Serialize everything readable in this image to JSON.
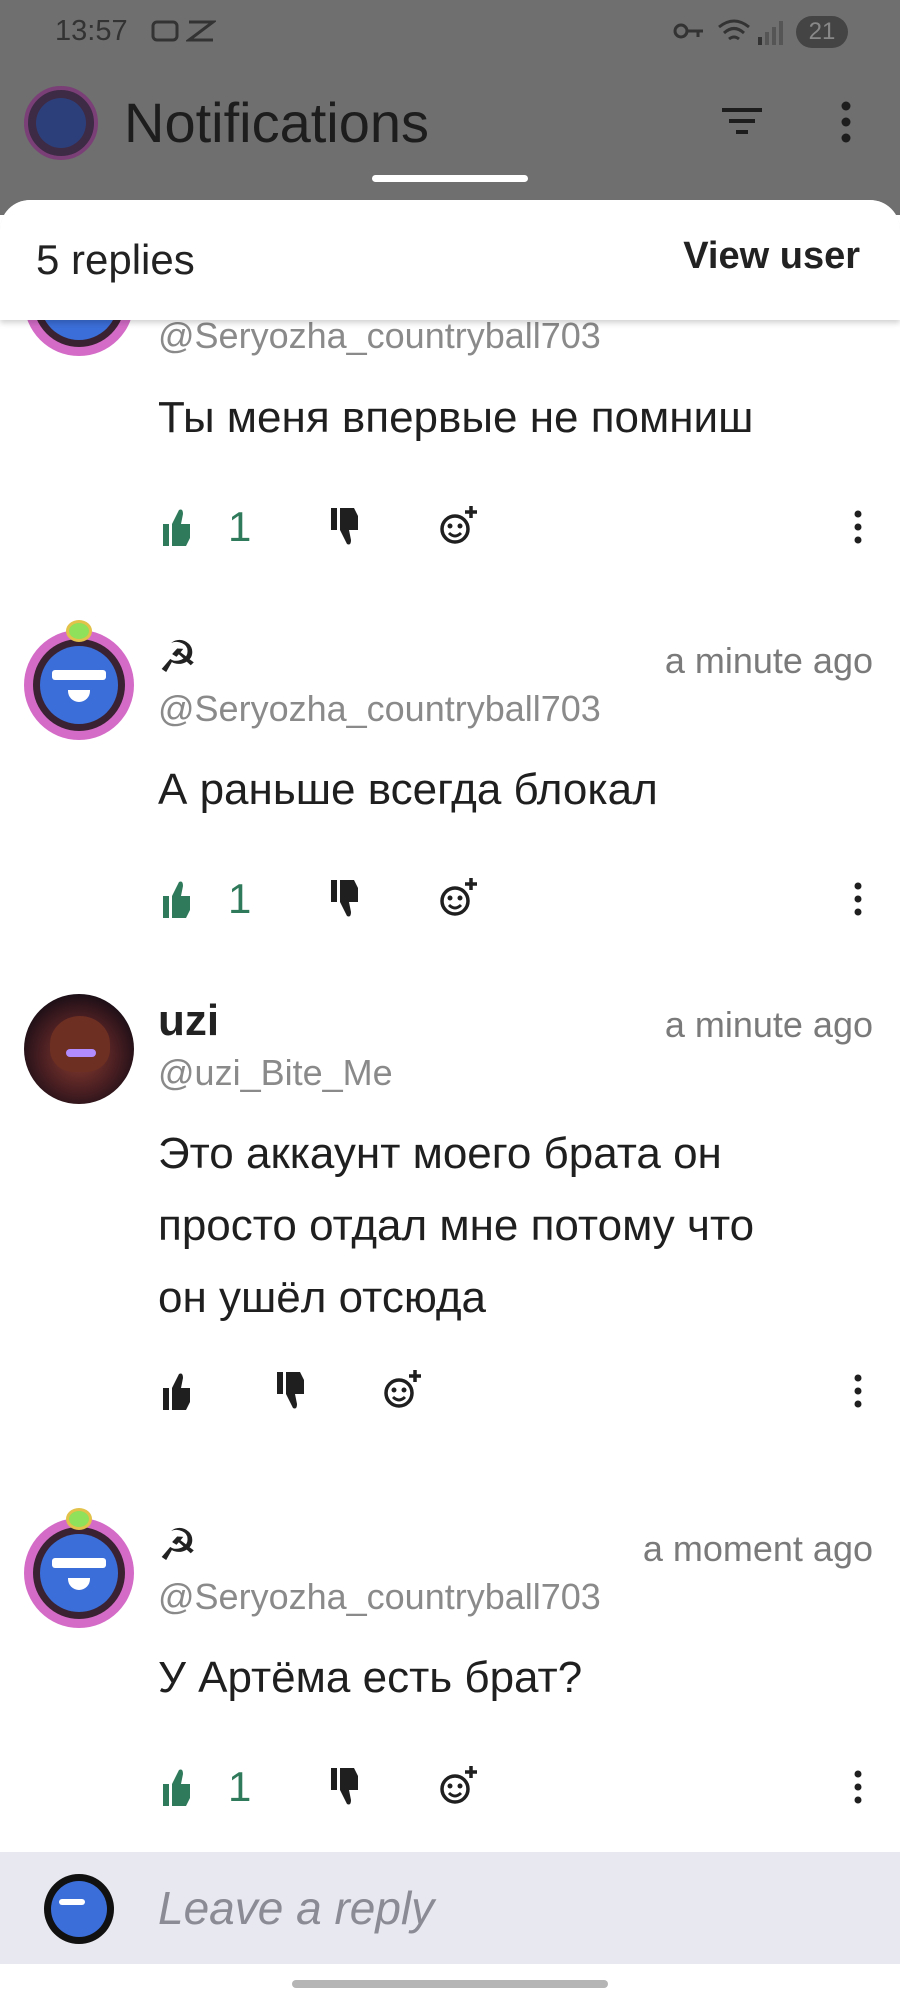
{
  "status_bar": {
    "time": "13:57",
    "battery": "21"
  },
  "app_bar": {
    "title": "Notifications"
  },
  "sheet": {
    "replies_count": "5 replies",
    "view_user_label": "View user"
  },
  "comments": [
    {
      "name": "",
      "time": "",
      "handle": "@Seryozha_countryball703",
      "lines": [
        "Ты меня впервые не помниш"
      ],
      "likes": "1"
    },
    {
      "name": "☭",
      "time": "a minute ago",
      "handle": "@Seryozha_countryball703",
      "lines": [
        "А раньше всегда блокал"
      ],
      "likes": "1"
    },
    {
      "name": "uzi",
      "time": "a minute ago",
      "handle": "@uzi_Bite_Me",
      "lines": [
        "Это аккаунт моего брата он",
        "просто отдал мне потому что",
        "он ушёл отсюда"
      ],
      "likes": ""
    },
    {
      "name": "☭",
      "time": "a moment ago",
      "handle": "@Seryozha_countryball703",
      "lines": [
        "У Артёма есть брат?"
      ],
      "likes": "1"
    }
  ],
  "reply_bar": {
    "placeholder": "Leave a reply"
  },
  "colors": {
    "accent_green": "#2f7a5a",
    "scrim": "#6f6f6f"
  },
  "icons": [
    "filter-icon",
    "kebab-icon",
    "thumbs-up-icon",
    "thumbs-down-icon",
    "add-reaction-icon",
    "more-icon"
  ]
}
